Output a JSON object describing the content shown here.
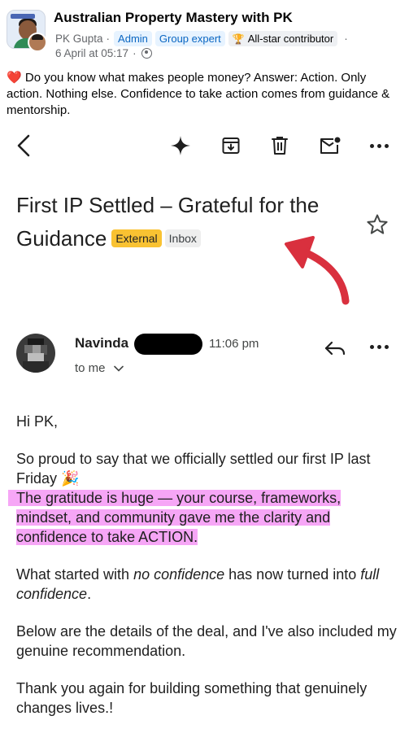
{
  "post": {
    "group_name": "Australian Property Mastery with PK",
    "author": "PK Gupta",
    "separator": "·",
    "badges": [
      "Admin",
      "Group expert",
      "All-star contributor"
    ],
    "date": "6 April at 05:17",
    "text_prefix": "❤️",
    "text": "Do you know what makes people money? Answer: Action. Only action. Nothing else. Confidence to take action comes from guidance & mentorship."
  },
  "toolbar": {
    "icons": [
      "back-arrow-icon",
      "gemini-sparkle-icon",
      "archive-icon",
      "delete-icon",
      "mark-unread-icon",
      "more-icon"
    ]
  },
  "email": {
    "subject": "First IP Settled – Grateful for the Guidance",
    "labels": {
      "external": "External",
      "inbox": "Inbox"
    },
    "sender_name": "Navinda",
    "time": "11:06 pm",
    "recipient": "to me",
    "greeting": "Hi PK,",
    "para1_plain": "So proud to say that we officially settled our first IP last Friday 🎉",
    "para1_highlight": "The gratitude is huge — your course, frameworks, mindset, and community gave me the clarity and confidence to take ACTION.",
    "para2_a": "What started with ",
    "para2_em1": "no confidence",
    "para2_b": " has now turned into ",
    "para2_em2": "full confidence",
    "para2_c": ".",
    "para3": "Below are the details of the deal, and I've also included my genuine recommendation.",
    "para4": "Thank you again for building something that genuinely changes lives.!"
  },
  "colors": {
    "highlight": "#f6a6f6",
    "external_label": "#f9c232",
    "annotation_arrow": "#d9303e",
    "badge_blue": "#0a66c2"
  }
}
